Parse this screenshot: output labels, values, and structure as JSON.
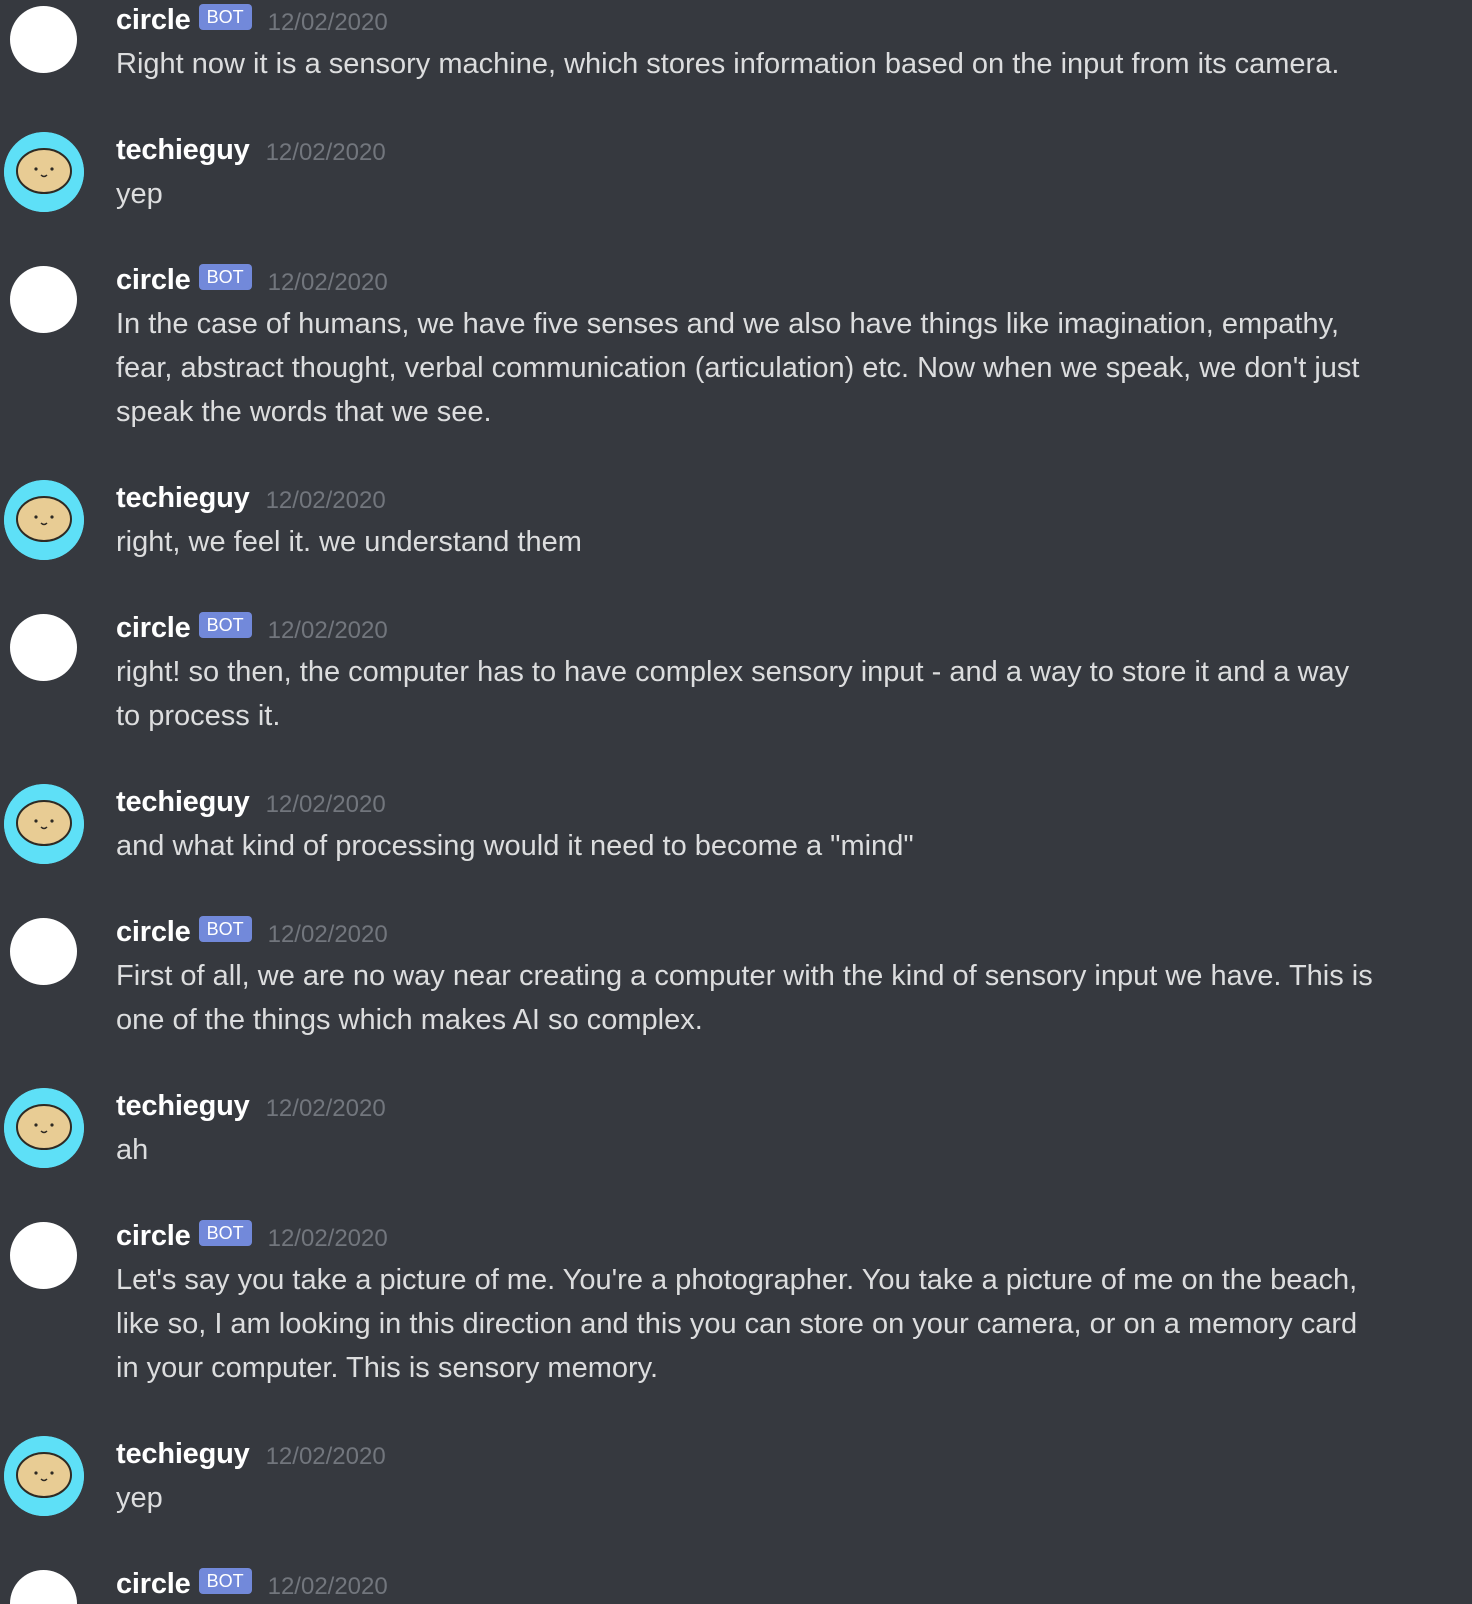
{
  "colors": {
    "background": "#36393f",
    "username": "#ffffff",
    "message_text": "#dcddde",
    "timestamp": "#72767d",
    "bot_badge": "#7289da",
    "avatar_techieguy_ring": "#5ee0f7",
    "avatar_techieguy_face": "#e8cc94",
    "avatar_circle": "#ffffff"
  },
  "messages": [
    {
      "author": "circle",
      "badge": "BOT",
      "timestamp": "12/02/2020",
      "avatar_icon": "white-circle-avatar",
      "text": "Right now it is a sensory machine, which stores information based on the input from its camera."
    },
    {
      "author": "techieguy",
      "timestamp": "12/02/2020",
      "avatar_icon": "smiling-face-avatar",
      "text": "yep"
    },
    {
      "author": "circle",
      "badge": "BOT",
      "timestamp": "12/02/2020",
      "avatar_icon": "white-circle-avatar",
      "text": "In the case of humans, we have five senses and we also have things like imagination, empathy, fear, abstract thought, verbal communication (articulation) etc. Now when we speak, we don't just speak the words that we see."
    },
    {
      "author": "techieguy",
      "timestamp": "12/02/2020",
      "avatar_icon": "smiling-face-avatar",
      "text": "right, we feel it. we understand them"
    },
    {
      "author": "circle",
      "badge": "BOT",
      "timestamp": "12/02/2020",
      "avatar_icon": "white-circle-avatar",
      "text": "right! so then, the computer has to have complex sensory input - and a way to store it and a way to process it."
    },
    {
      "author": "techieguy",
      "timestamp": "12/02/2020",
      "avatar_icon": "smiling-face-avatar",
      "text": "and what kind of processing would it need to become a \"mind\""
    },
    {
      "author": "circle",
      "badge": "BOT",
      "timestamp": "12/02/2020",
      "avatar_icon": "white-circle-avatar",
      "text": "First of all, we are no way near creating a computer with the kind of sensory input we have. This is one of the things which makes AI so complex."
    },
    {
      "author": "techieguy",
      "timestamp": "12/02/2020",
      "avatar_icon": "smiling-face-avatar",
      "text": "ah"
    },
    {
      "author": "circle",
      "badge": "BOT",
      "timestamp": "12/02/2020",
      "avatar_icon": "white-circle-avatar",
      "text": "Let's say you take a picture of me. You're a photographer. You take a picture of me on the beach, like so, I am looking in this direction and this you can store on your camera, or on a memory card in your computer. This is sensory memory."
    },
    {
      "author": "techieguy",
      "timestamp": "12/02/2020",
      "avatar_icon": "smiling-face-avatar",
      "text": "yep"
    },
    {
      "author": "circle",
      "badge": "BOT",
      "timestamp": "12/02/2020",
      "avatar_icon": "white-circle-avatar",
      "text": ""
    }
  ]
}
